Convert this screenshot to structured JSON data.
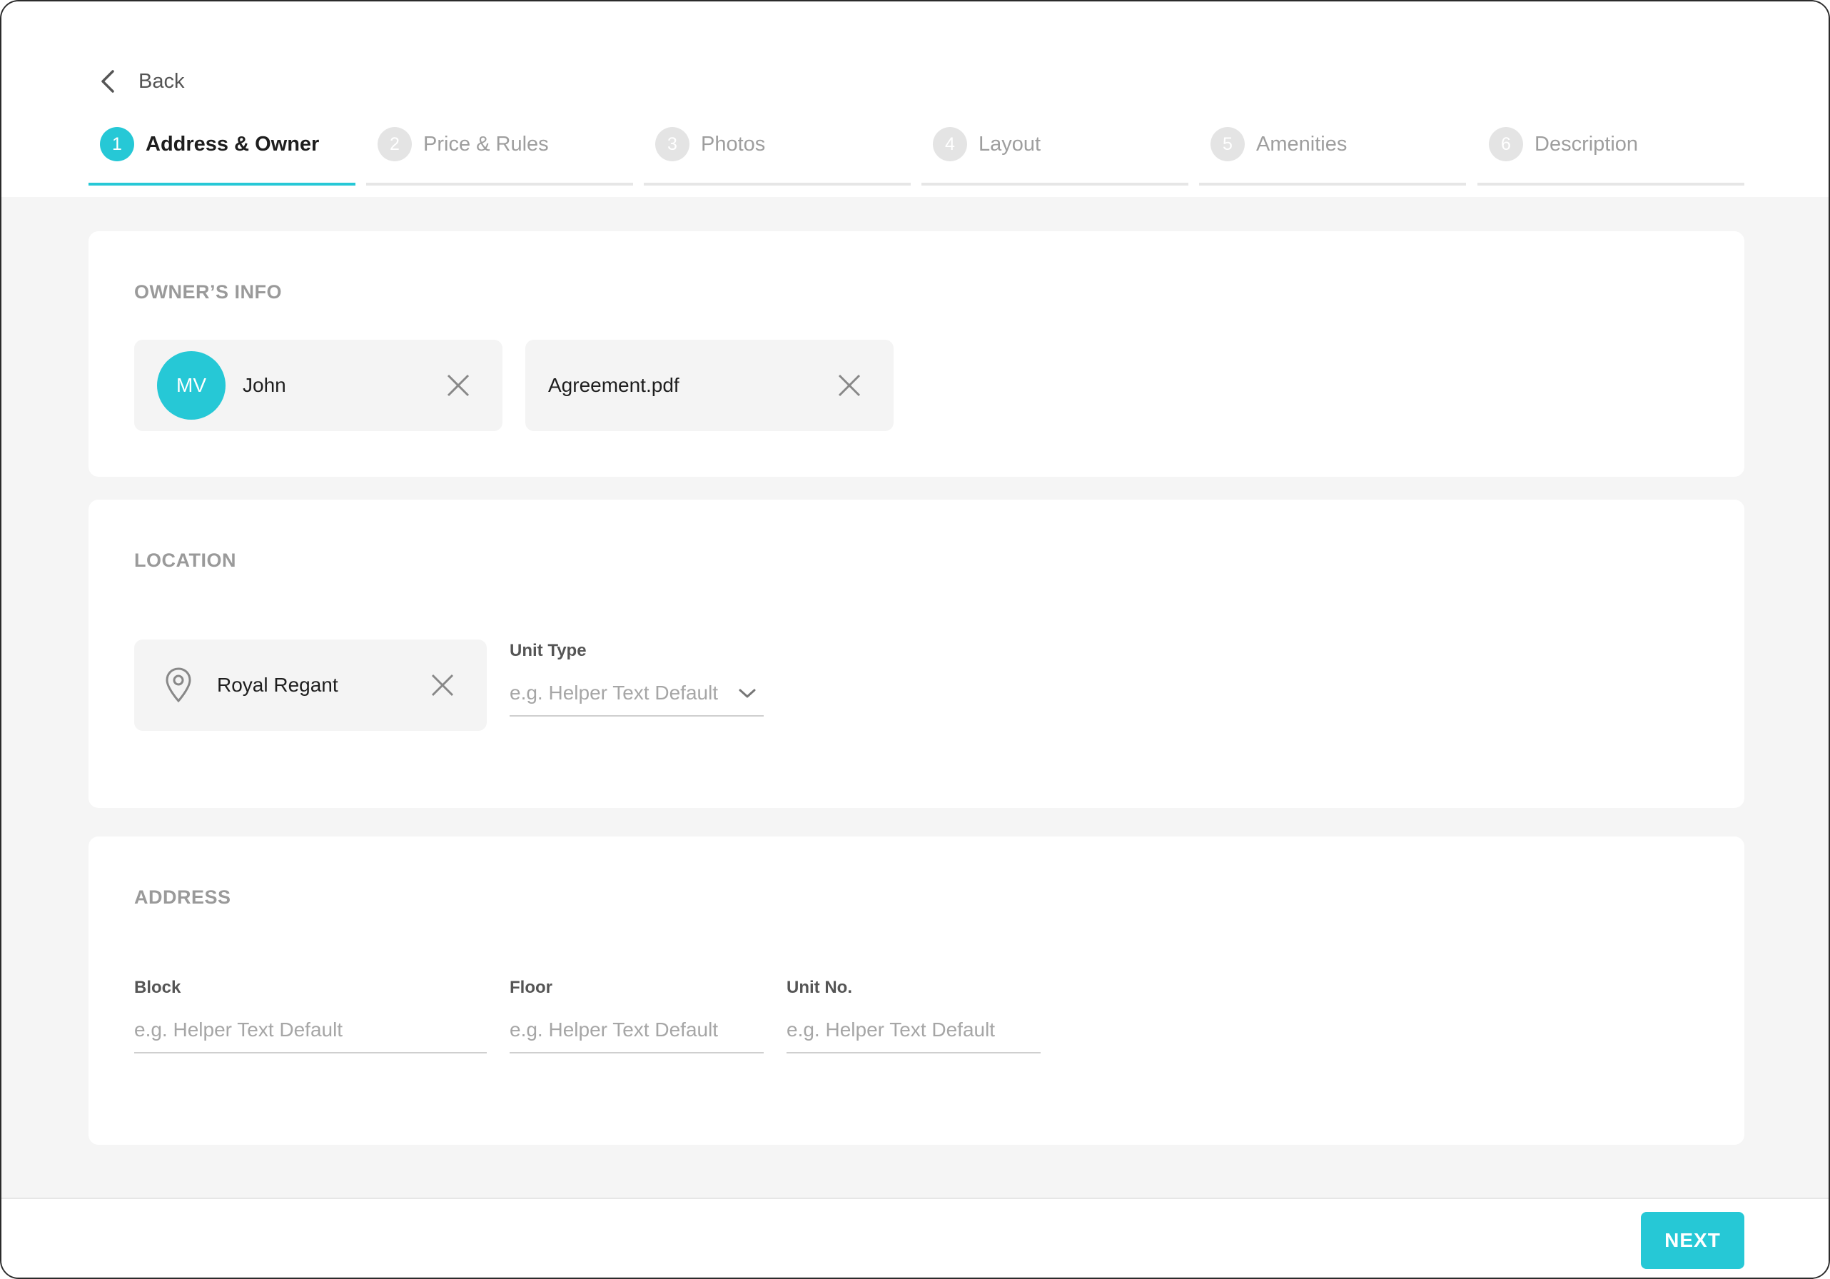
{
  "nav": {
    "back_label": "Back"
  },
  "steps": [
    {
      "number": "1",
      "label": "Address & Owner",
      "active": true
    },
    {
      "number": "2",
      "label": "Price & Rules",
      "active": false
    },
    {
      "number": "3",
      "label": "Photos",
      "active": false
    },
    {
      "number": "4",
      "label": "Layout",
      "active": false
    },
    {
      "number": "5",
      "label": "Amenities",
      "active": false
    },
    {
      "number": "6",
      "label": "Description",
      "active": false
    }
  ],
  "owner_info": {
    "title": "OWNER’S INFO",
    "owner": {
      "initials": "MV",
      "name": "John"
    },
    "document": {
      "filename": "Agreement.pdf"
    }
  },
  "location": {
    "title": "LOCATION",
    "place": "Royal Regant",
    "unit_type": {
      "label": "Unit Type",
      "placeholder": "e.g. Helper Text Default"
    }
  },
  "address": {
    "title": "ADDRESS",
    "block": {
      "label": "Block",
      "placeholder": "e.g. Helper Text Default"
    },
    "floor": {
      "label": "Floor",
      "placeholder": "e.g. Helper Text Default"
    },
    "unit_no": {
      "label": "Unit No.",
      "placeholder": "e.g. Helper Text Default"
    }
  },
  "footer": {
    "next_label": "NEXT"
  },
  "colors": {
    "accent": "#26c8d6",
    "inactive_step": "#e4e4e4",
    "background": "#f5f5f5"
  },
  "icons": {
    "back": "chevron-left-icon",
    "close": "close-icon",
    "location": "location-pin-icon",
    "dropdown": "chevron-down-icon"
  }
}
